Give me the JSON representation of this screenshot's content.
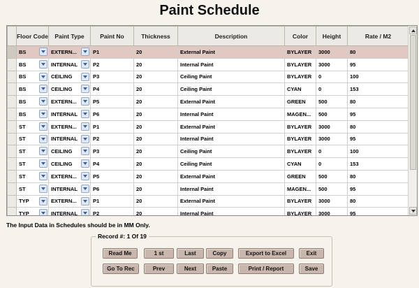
{
  "title": "Paint Schedule",
  "columns": [
    "Floor Code",
    "Paint Type",
    "Paint No",
    "Thickness",
    "Description",
    "Color",
    "Height",
    "Rate / M2"
  ],
  "rows": [
    {
      "floor": "BS",
      "type": "EXTERN...",
      "no": "P1",
      "thick": "20",
      "desc": "External Paint",
      "color": "BYLAYER",
      "height": "3000",
      "rate": "80"
    },
    {
      "floor": "BS",
      "type": "INTERNAL",
      "no": "P2",
      "thick": "20",
      "desc": "Internal Paint",
      "color": "BYLAYER",
      "height": "3000",
      "rate": "95"
    },
    {
      "floor": "BS",
      "type": "CEILING",
      "no": "P3",
      "thick": "20",
      "desc": "Ceiling Paint",
      "color": "BYLAYER",
      "height": "0",
      "rate": "100"
    },
    {
      "floor": "BS",
      "type": "CEILING",
      "no": "P4",
      "thick": "20",
      "desc": "Ceiling Paint",
      "color": "CYAN",
      "height": "0",
      "rate": "153"
    },
    {
      "floor": "BS",
      "type": "EXTERN...",
      "no": "P5",
      "thick": "20",
      "desc": "External Paint",
      "color": "GREEN",
      "height": "500",
      "rate": "80"
    },
    {
      "floor": "BS",
      "type": "INTERNAL",
      "no": "P6",
      "thick": "20",
      "desc": "Internal Paint",
      "color": "MAGEN...",
      "height": "500",
      "rate": "95"
    },
    {
      "floor": "ST",
      "type": "EXTERN...",
      "no": "P1",
      "thick": "20",
      "desc": "External Paint",
      "color": "BYLAYER",
      "height": "3000",
      "rate": "80"
    },
    {
      "floor": "ST",
      "type": "INTERNAL",
      "no": "P2",
      "thick": "20",
      "desc": "Internal Paint",
      "color": "BYLAYER",
      "height": "3000",
      "rate": "95"
    },
    {
      "floor": "ST",
      "type": "CEILING",
      "no": "P3",
      "thick": "20",
      "desc": "Ceiling Paint",
      "color": "BYLAYER",
      "height": "0",
      "rate": "100"
    },
    {
      "floor": "ST",
      "type": "CEILING",
      "no": "P4",
      "thick": "20",
      "desc": "Ceiling Paint",
      "color": "CYAN",
      "height": "0",
      "rate": "153"
    },
    {
      "floor": "ST",
      "type": "EXTERN...",
      "no": "P5",
      "thick": "20",
      "desc": "External Paint",
      "color": "GREEN",
      "height": "500",
      "rate": "80"
    },
    {
      "floor": "ST",
      "type": "INTERNAL",
      "no": "P6",
      "thick": "20",
      "desc": "Internal Paint",
      "color": "MAGEN...",
      "height": "500",
      "rate": "95"
    },
    {
      "floor": "TYP",
      "type": "EXTERN...",
      "no": "P1",
      "thick": "20",
      "desc": "External Paint",
      "color": "BYLAYER",
      "height": "3000",
      "rate": "80"
    },
    {
      "floor": "TYP",
      "type": "INTERNAL",
      "no": "P2",
      "thick": "20",
      "desc": "Internal Paint",
      "color": "BYLAYER",
      "height": "3000",
      "rate": "95"
    }
  ],
  "selected_row": 0,
  "note": "The Input Data in Schedules should be in MM Only.",
  "record_label": "Record #: 1 Of 19",
  "buttons": {
    "read_me": "Read Me",
    "first": "1 st",
    "last": "Last",
    "copy": "Copy",
    "export": "Export to Excel",
    "exit": "Exit",
    "go_to_rec": "Go To Rec",
    "prev": "Prev",
    "next": "Next",
    "paste": "Paste",
    "print": "Print / Report",
    "save": "Save"
  },
  "colors": {
    "background": "#f6f3ec",
    "selected_row": "#e0c9c3",
    "button": "#c9b6ad"
  }
}
